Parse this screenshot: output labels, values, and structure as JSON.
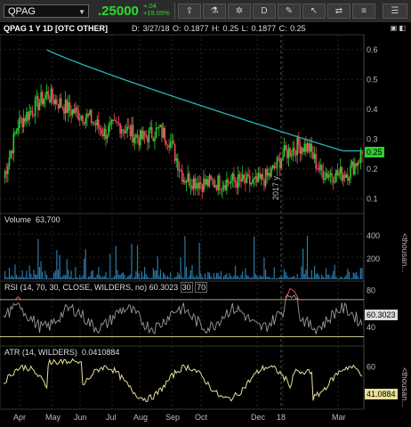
{
  "toolbar": {
    "symbol": "QPAG",
    "price": ".25000",
    "change_abs": "+.04",
    "change_pct": "+19.05%",
    "buttons": [
      "share-icon",
      "flask-icon",
      "settings-icon",
      "draw-icon",
      "pointer-icon",
      "compare-icon"
    ]
  },
  "header": {
    "title": "QPAG 1 Y 1D [OTC OTHER]",
    "info": "D: 3/27/18  O: 0.1877  H: 0.25  L: 0.1877  C: 0.25"
  },
  "price_panel": {
    "current_label": "0.25",
    "axis_ticks": [
      "0.6",
      "0.5",
      "0.4",
      "0.3",
      "0.2",
      "0.1"
    ],
    "year_watermark": "2017 y"
  },
  "volume_panel": {
    "label": "Volume",
    "value": "63,700",
    "axis_ticks": [
      "400",
      "200"
    ],
    "unit": "<thousan..."
  },
  "rsi_panel": {
    "label": "RSI (14, 70, 30, CLOSE, WILDERS, no)",
    "value": "60.3023",
    "low": "30",
    "high": "70",
    "axis_ticks": [
      "80",
      "40"
    ],
    "current_label": "60.3023"
  },
  "atr_panel": {
    "label": "ATR (14, WILDERS)",
    "value": "0.0410884",
    "axis_ticks": [
      "60"
    ],
    "current_label": "41.0884",
    "unit": "<thousan..."
  },
  "x_axis": [
    "Apr",
    "May",
    "Jun",
    "Jul",
    "Aug",
    "Sep",
    "Oct",
    "Dec",
    "18",
    "Mar"
  ],
  "colors": {
    "up": "#2ecc2e",
    "down": "#e84a5f",
    "ma": "#2ab3b8",
    "rsi_line": "#9a9a9a",
    "atr_line": "#e8df9a"
  }
}
